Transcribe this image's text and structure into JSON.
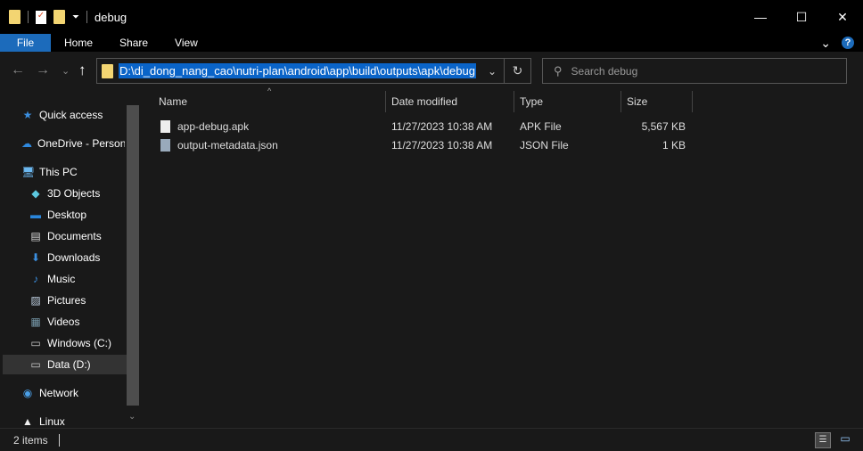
{
  "window": {
    "title": "debug",
    "minimize": "—",
    "maximize": "☐",
    "close": "✕"
  },
  "ribbon": {
    "tabs": [
      "File",
      "Home",
      "Share",
      "View"
    ],
    "expand": "⌄",
    "help": "?"
  },
  "nav": {
    "back": "←",
    "forward": "→",
    "recent": "⌄",
    "up": "↑",
    "address": "D:\\di_dong_nang_cao\\nutri-plan\\android\\app\\build\\outputs\\apk\\debug",
    "dropdown": "⌄",
    "refresh": "↻",
    "search_placeholder": "Search debug"
  },
  "sidebar": {
    "items": [
      {
        "label": "Quick access",
        "icon": "star-icon"
      },
      {
        "label": "OneDrive - Personal",
        "icon": "cloud-icon"
      },
      {
        "label": "This PC",
        "icon": "computer-icon"
      },
      {
        "label": "3D Objects",
        "icon": "cube-icon"
      },
      {
        "label": "Desktop",
        "icon": "desktop-icon"
      },
      {
        "label": "Documents",
        "icon": "document-icon"
      },
      {
        "label": "Downloads",
        "icon": "download-icon"
      },
      {
        "label": "Music",
        "icon": "music-icon"
      },
      {
        "label": "Pictures",
        "icon": "picture-icon"
      },
      {
        "label": "Videos",
        "icon": "video-icon"
      },
      {
        "label": "Windows (C:)",
        "icon": "drive-icon"
      },
      {
        "label": "Data (D:)",
        "icon": "drive-icon",
        "selected": true
      },
      {
        "label": "Network",
        "icon": "network-icon"
      },
      {
        "label": "Linux",
        "icon": "linux-icon"
      }
    ]
  },
  "columns": [
    "Name",
    "Date modified",
    "Type",
    "Size"
  ],
  "files": [
    {
      "name": "app-debug.apk",
      "date": "11/27/2023 10:38 AM",
      "type": "APK File",
      "size": "5,567 KB"
    },
    {
      "name": "output-metadata.json",
      "date": "11/27/2023 10:38 AM",
      "type": "JSON File",
      "size": "1 KB"
    }
  ],
  "status": {
    "count": "2 items"
  },
  "colors": {
    "accent": "#1c6bbb",
    "selection": "#0a64c8"
  }
}
